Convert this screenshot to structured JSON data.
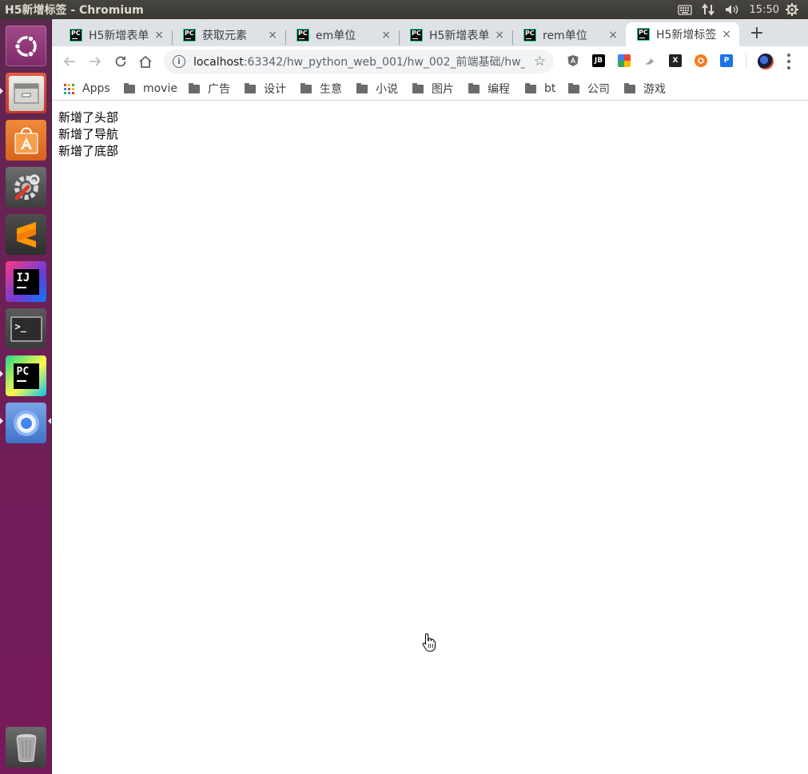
{
  "system_bar": {
    "window_title": "H5新增标签 - Chromium",
    "clock": "15:50"
  },
  "launcher": {
    "items": [
      {
        "name": "ubuntu-dash",
        "icon": "ubuntu-logo-icon"
      },
      {
        "name": "files",
        "icon": "file-cabinet-icon"
      },
      {
        "name": "software-center",
        "icon": "shopping-bag-icon"
      },
      {
        "name": "system-settings",
        "icon": "wrench-gear-icon"
      },
      {
        "name": "sublime-text",
        "icon": "sublime-icon"
      },
      {
        "name": "intellij",
        "icon": "intellij-icon",
        "label": "IJ"
      },
      {
        "name": "terminal",
        "icon": "terminal-icon",
        "label": ">_"
      },
      {
        "name": "pycharm",
        "icon": "pycharm-icon",
        "label": "PC"
      },
      {
        "name": "chromium",
        "icon": "chromium-icon"
      },
      {
        "name": "trash",
        "icon": "trash-icon"
      }
    ]
  },
  "tabs": [
    {
      "label": "H5新增表单",
      "favicon": "PC"
    },
    {
      "label": "获取元素",
      "favicon": "PC"
    },
    {
      "label": "em单位",
      "favicon": "PC"
    },
    {
      "label": "H5新增表单",
      "favicon": "PC"
    },
    {
      "label": "rem单位",
      "favicon": "PC"
    },
    {
      "label": "H5新增标签",
      "favicon": "PC",
      "active": true
    }
  ],
  "tab_close_glyph": "×",
  "new_tab_glyph": "+",
  "toolbar": {
    "url_host": "localhost",
    "url_path": ":63342/hw_python_web_001/hw_002_前端基础/hw_0...",
    "extensions": [
      {
        "name": "angular-ext",
        "label": "A",
        "color": "#5f6368"
      },
      {
        "name": "jetbrains-ext",
        "label": "JB",
        "color": "#000000"
      },
      {
        "name": "colorful-ext",
        "label": "",
        "color": "#e94235"
      },
      {
        "name": "bird-ext",
        "label": "",
        "color": "#9aa0a6"
      },
      {
        "name": "x-ext",
        "label": "X",
        "color": "#202124"
      },
      {
        "name": "orange-ext",
        "label": "",
        "color": "#f47c20"
      },
      {
        "name": "p-ext",
        "label": "P",
        "color": "#1a73e8"
      }
    ]
  },
  "bookmarks": {
    "apps_label": "Apps",
    "folders": [
      "movie",
      "广告",
      "设计",
      "生意",
      "小说",
      "图片",
      "编程",
      "bt",
      "公司",
      "游戏"
    ]
  },
  "page": {
    "lines": [
      "新增了头部",
      "新增了导航",
      "新增了底部"
    ]
  }
}
